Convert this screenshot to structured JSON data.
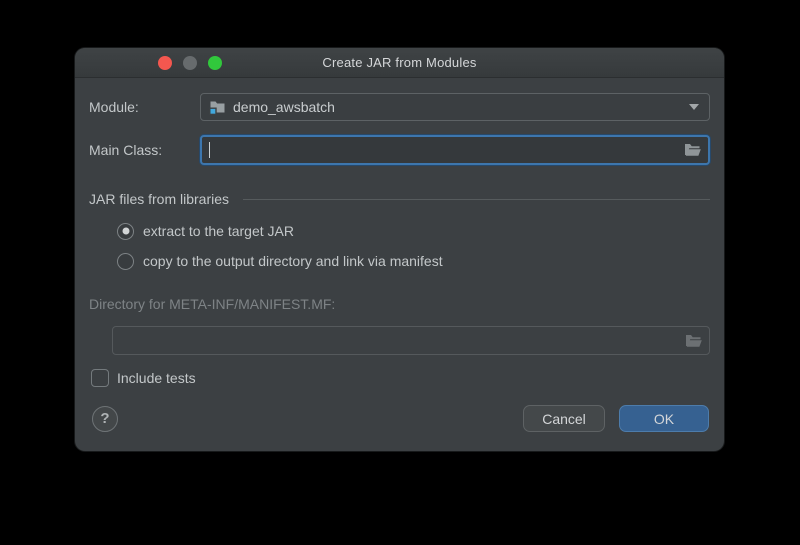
{
  "window": {
    "title": "Create JAR from Modules"
  },
  "form": {
    "module": {
      "label": "Module:",
      "value": "demo_awsbatch"
    },
    "main_class": {
      "label": "Main Class:",
      "value": ""
    },
    "libraries_section": {
      "title": "JAR files from libraries"
    },
    "jar_options": [
      {
        "label": "extract to the target JAR",
        "selected": true
      },
      {
        "label": "copy to the output directory and link via manifest",
        "selected": false
      }
    ],
    "manifest_dir": {
      "label": "Directory for META-INF/MANIFEST.MF:",
      "value": "",
      "disabled": true
    },
    "include_tests": {
      "label": "Include tests",
      "checked": false
    }
  },
  "footer": {
    "help": "?",
    "cancel": "Cancel",
    "ok": "OK"
  },
  "colors": {
    "dialog_bg": "#3c4043",
    "titlebar_bg": "#3a3e40",
    "accent_blue": "#366191",
    "focus_ring_blue": "#3d76ad",
    "module_icon_blue": "#41a8dd",
    "traffic_close_red": "#f4574f",
    "traffic_minimize_gray": "#676b6d",
    "traffic_zoom_green": "#31c83c"
  }
}
